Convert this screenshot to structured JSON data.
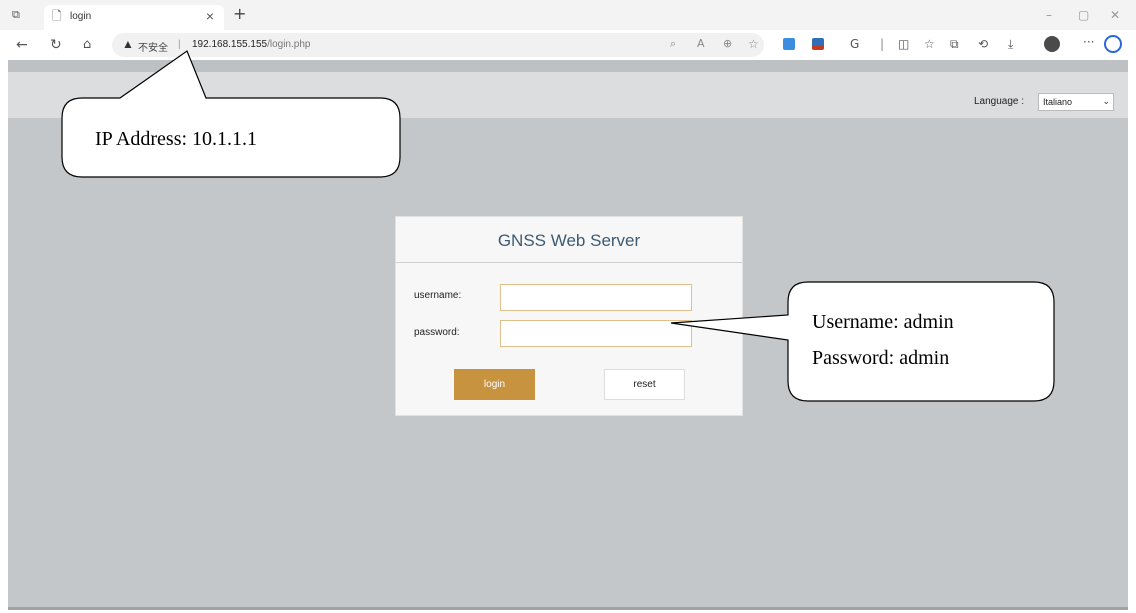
{
  "browser": {
    "tab_title": "login",
    "tab_close": "×",
    "new_tab": "+",
    "address_warning_icon": "▲",
    "address_unsafe_label": "不安全",
    "address_separator": "|",
    "url_host": "192.168.155.155",
    "url_path": "/login.php"
  },
  "page": {
    "language_label": "Language :",
    "language_value": "Italiano",
    "login_title": "GNSS Web Server",
    "username_label": "username:",
    "password_label": "password:",
    "login_button": "login",
    "reset_button": "reset"
  },
  "callouts": {
    "ip_note": "IP Address: 10.1.1.1",
    "username_note": "Username: admin",
    "password_note": "Password: admin"
  },
  "icons": {
    "tab_actions": "tab-actions-icon",
    "page": "page-icon",
    "back": "back-arrow-icon",
    "refresh": "refresh-icon",
    "home": "home-icon",
    "warning": "warning-icon",
    "dropdown": "chevron-down-icon"
  }
}
